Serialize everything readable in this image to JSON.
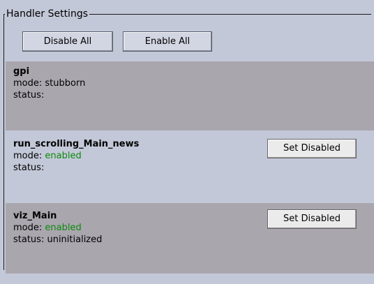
{
  "panel": {
    "legend": "Handler Settings"
  },
  "toolbar": {
    "disable_all_label": "Disable All",
    "enable_all_label": "Enable All"
  },
  "handlers": [
    {
      "name": "gpi",
      "mode_label": "mode:",
      "mode_value": "stubborn",
      "status_label": "status:",
      "status_value": "",
      "action_label": ""
    },
    {
      "name": "run_scrolling_Main_news",
      "mode_label": "mode:",
      "mode_value": "enabled",
      "status_label": "status:",
      "status_value": "",
      "action_label": "Set Disabled"
    },
    {
      "name": "viz_Main",
      "mode_label": "mode:",
      "mode_value": "enabled",
      "status_label": "status:",
      "status_value": "uninitialized",
      "action_label": "Set Disabled"
    }
  ],
  "colors": {
    "panel_background": "#c3c8d8",
    "handler_dark_background": "#a9a6ae",
    "enabled_text": "#0a8a0a"
  }
}
